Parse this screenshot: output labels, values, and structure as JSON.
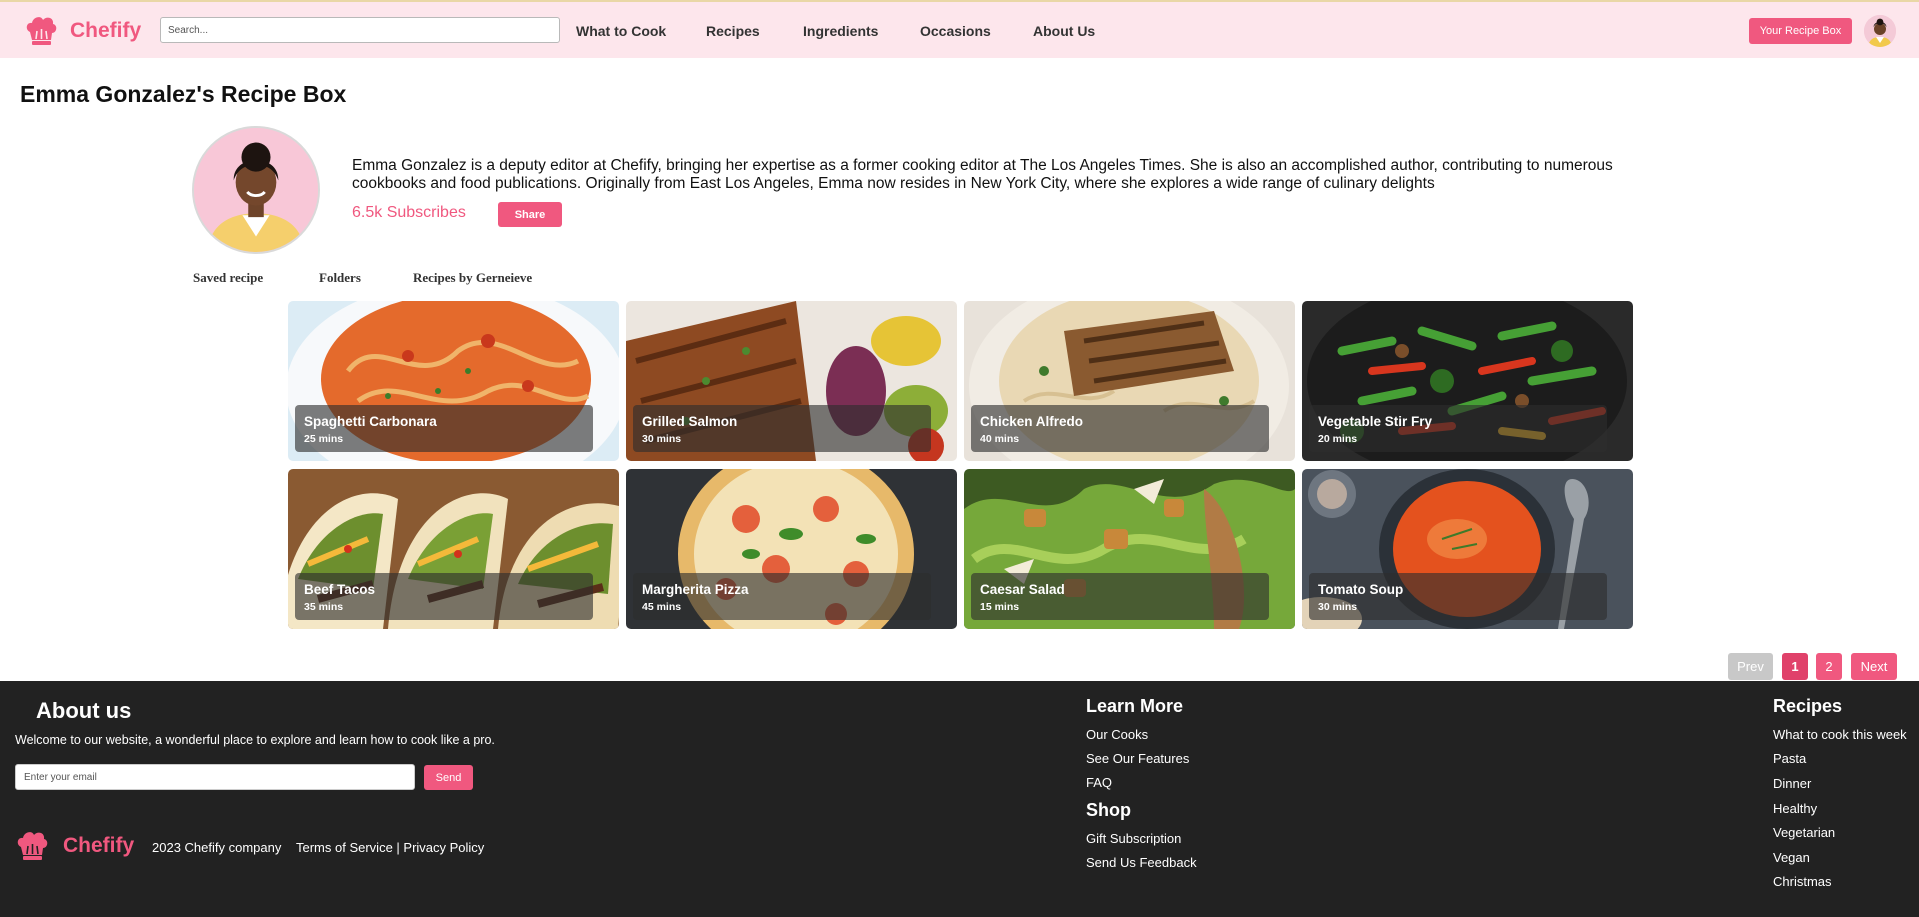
{
  "header": {
    "brand": "Chefify",
    "search_placeholder": "Search...",
    "nav": [
      "What to Cook",
      "Recipes",
      "Ingredients",
      "Occasions",
      "About Us"
    ],
    "recipe_box_button": "Your Recipe Box"
  },
  "profile": {
    "title": "Emma Gonzalez's Recipe Box",
    "bio": "Emma Gonzalez is a deputy editor at Chefify, bringing her expertise as a former cooking editor at The Los Angeles Times. She is also an accomplished author, contributing to numerous cookbooks and food publications. Originally from East Los Angeles, Emma now resides in New York City, where she explores a wide range of culinary delights",
    "subscribes": "6.5k Subscribes",
    "share_button": "Share",
    "tabs": [
      "Saved recipe",
      "Folders",
      "Recipes by Gerneieve"
    ]
  },
  "recipes": [
    {
      "title": "Spaghetti Carbonara",
      "time": "25 mins"
    },
    {
      "title": "Grilled Salmon",
      "time": "30 mins"
    },
    {
      "title": "Chicken Alfredo",
      "time": "40 mins"
    },
    {
      "title": "Vegetable Stir Fry",
      "time": "20 mins"
    },
    {
      "title": "Beef Tacos",
      "time": "35 mins"
    },
    {
      "title": "Margherita Pizza",
      "time": "45 mins"
    },
    {
      "title": "Caesar Salad",
      "time": "15 mins"
    },
    {
      "title": "Tomato Soup",
      "time": "30 mins"
    }
  ],
  "pagination": {
    "prev": "Prev",
    "pages": [
      "1",
      "2"
    ],
    "current": "1",
    "next": "Next"
  },
  "footer": {
    "about_heading": "About us",
    "about_text": "Welcome to our website, a wonderful place to explore and learn how to cook like a pro.",
    "email_placeholder": "Enter your email",
    "send_button": "Send",
    "brand": "Chefify",
    "copyright": "2023 Chefify company",
    "legal": "Terms of Service | Privacy Policy",
    "learn_more_heading": "Learn More",
    "learn_more_links": [
      "Our Cooks",
      "See Our Features",
      "FAQ"
    ],
    "shop_heading": "Shop",
    "shop_links": [
      "Gift Subscription",
      "Send Us Feedback"
    ],
    "recipes_heading": "Recipes",
    "recipes_links": [
      "What to cook this week",
      "Pasta",
      "Dinner",
      "Healthy",
      "Vegetarian",
      "Vegan",
      "Christmas"
    ]
  },
  "colors": {
    "accent": "#f0587f",
    "header_bg": "#fde6ec",
    "footer_bg": "#222222",
    "current_page": "#e0416a",
    "prev_disabled": "#c8c8c8"
  },
  "icons": {
    "logo": "chef-hat-icon",
    "avatar": "user-avatar"
  }
}
